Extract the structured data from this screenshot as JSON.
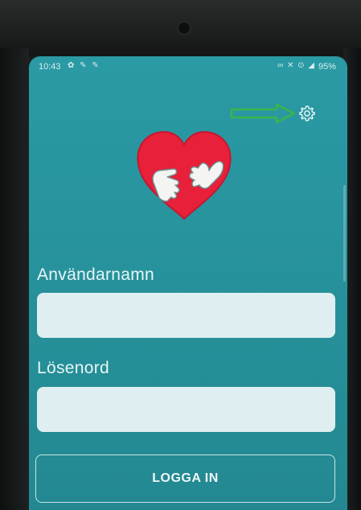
{
  "status_bar": {
    "time": "10:43",
    "notifications": "✿ ✎ ✎",
    "system_icons": "∞ ✕ ⊙ ◢",
    "battery": "95%"
  },
  "settings": {
    "icon": "gear-icon"
  },
  "annotation": {
    "arrow_color": "#3ab54a"
  },
  "logo": {
    "icon": "heart-hug-icon",
    "heart_color": "#e8203a"
  },
  "login_form": {
    "username_label": "Användarnamn",
    "username_value": "",
    "password_label": "Lösenord",
    "password_value": "",
    "login_button": "LOGGA IN"
  },
  "colors": {
    "background": "#27939d",
    "field_bg": "#dfeef0",
    "text": "#e8f6f7"
  }
}
